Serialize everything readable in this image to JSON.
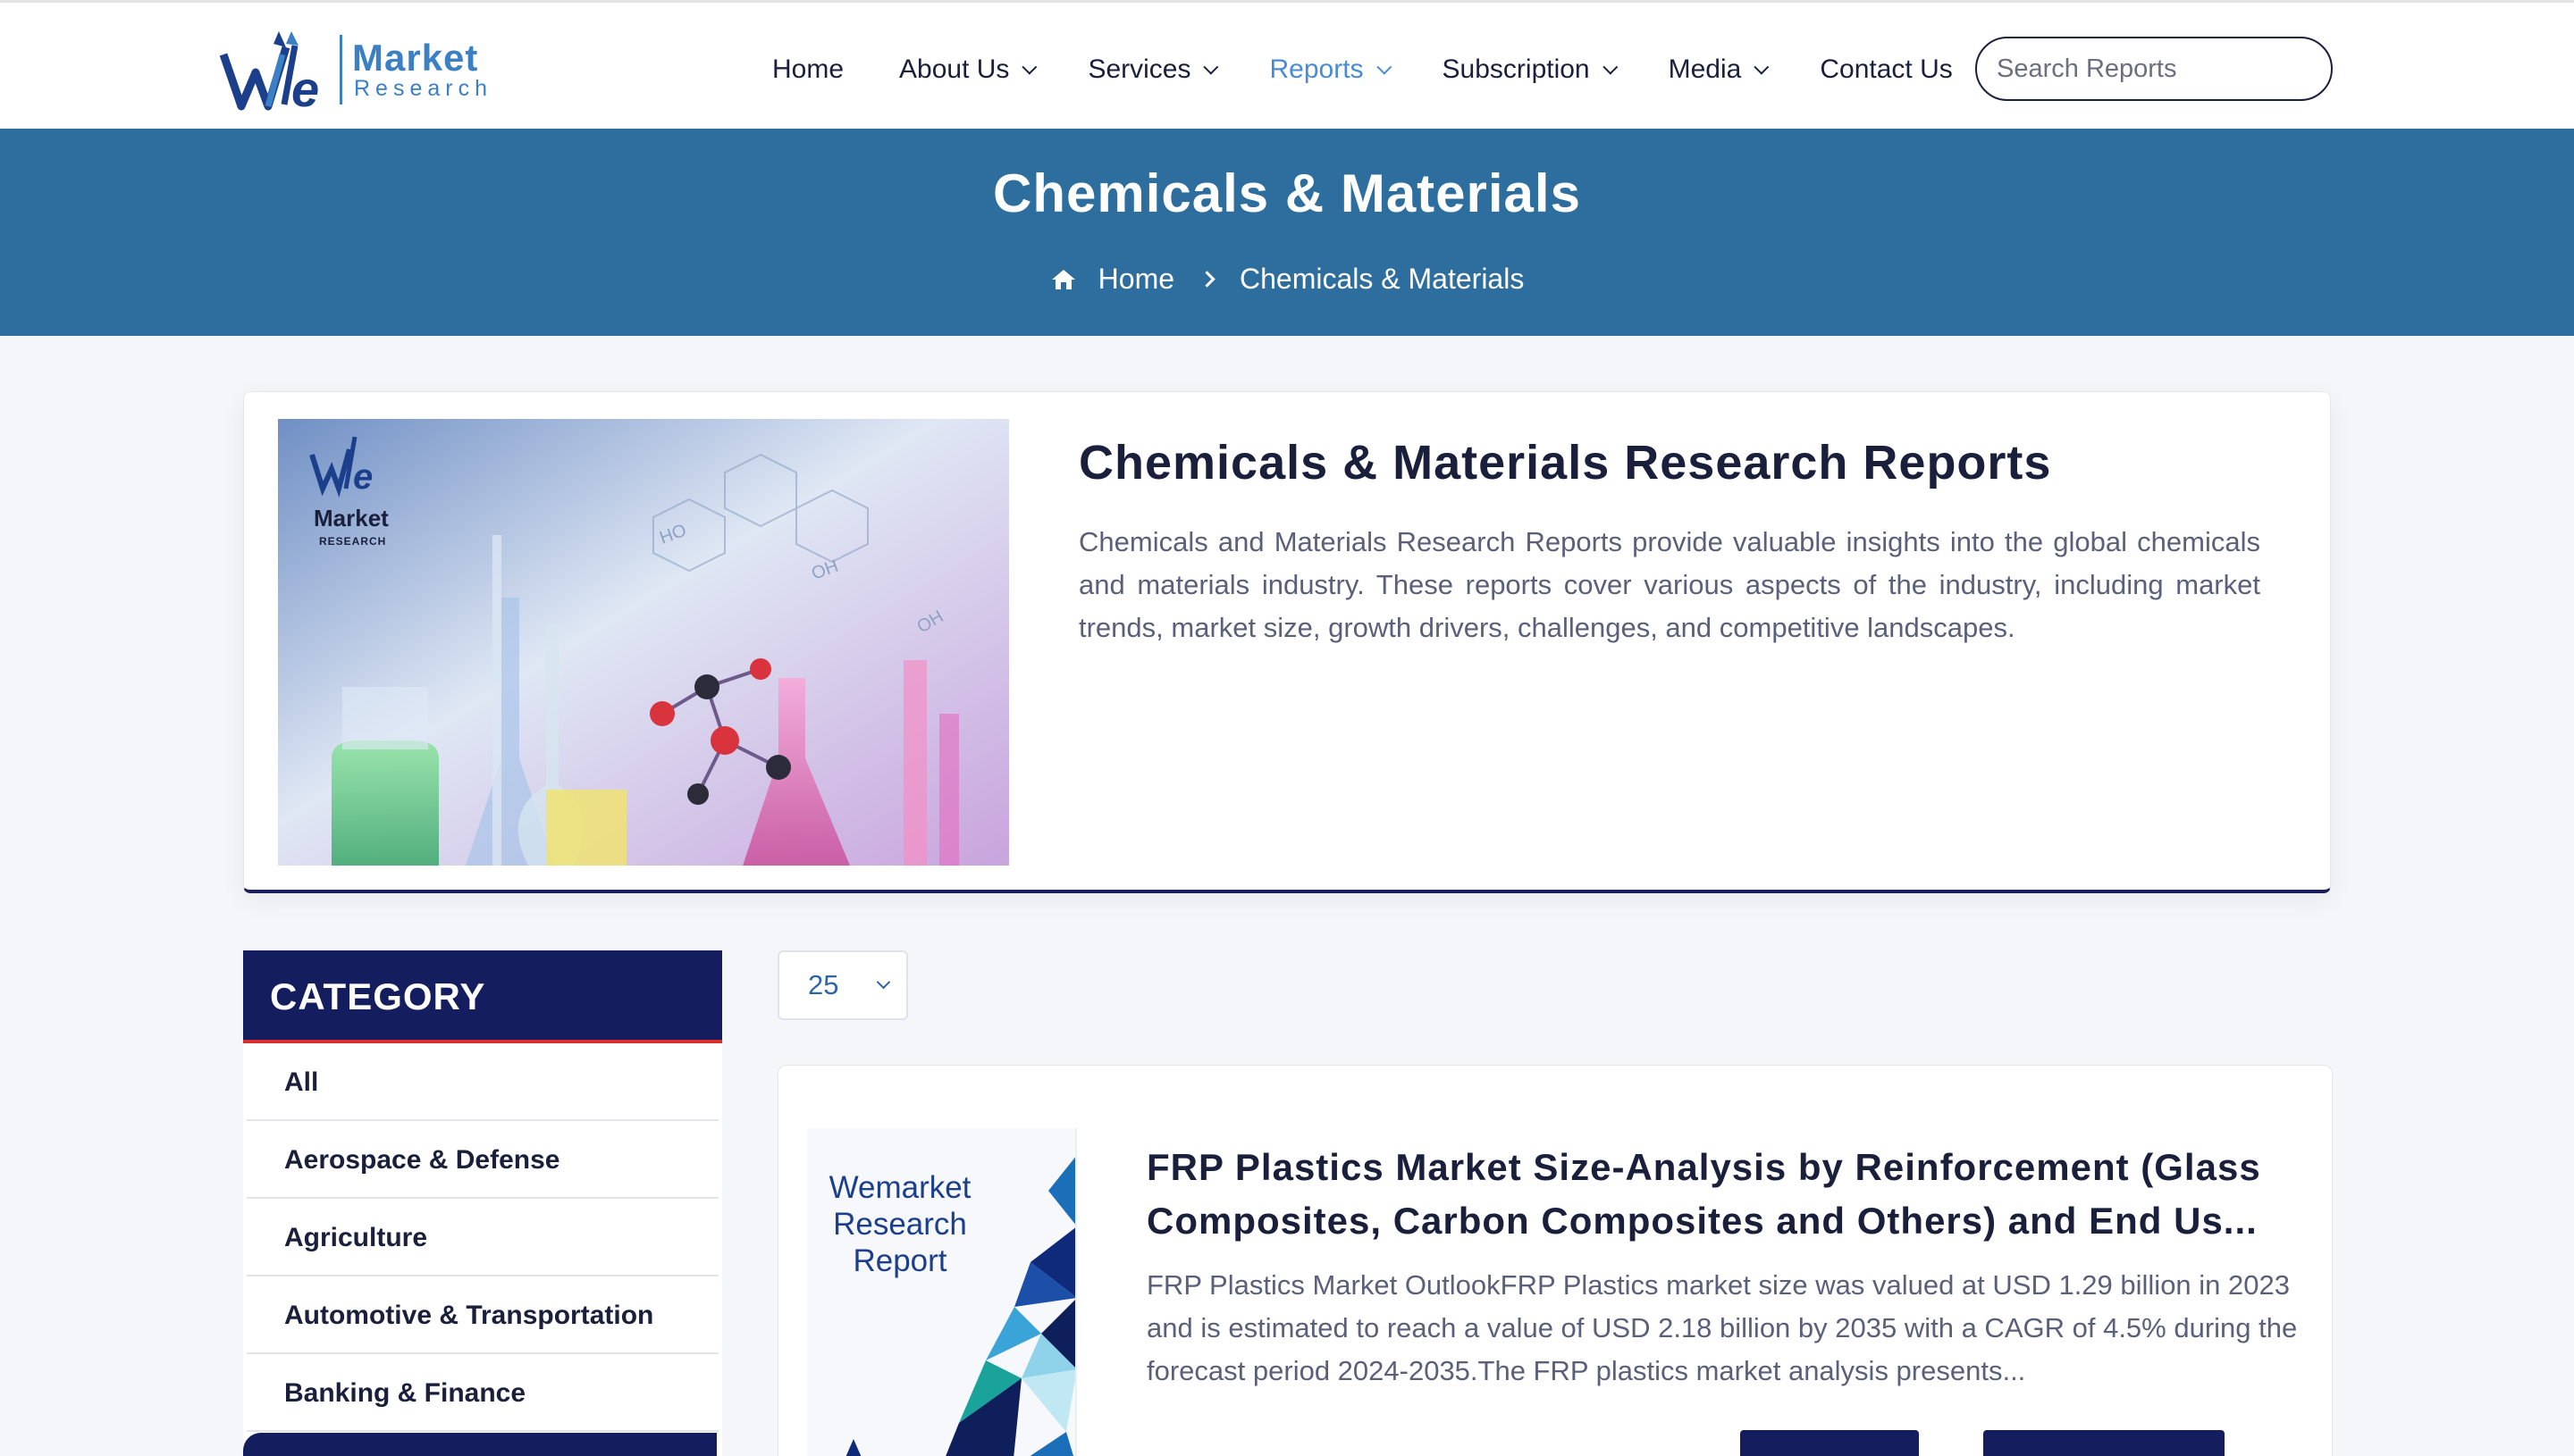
{
  "logo": {
    "main": "Market",
    "sub": "Research"
  },
  "nav": {
    "items": [
      {
        "label": "Home",
        "dropdown": false,
        "active": false
      },
      {
        "label": "About Us",
        "dropdown": true,
        "active": false
      },
      {
        "label": "Services",
        "dropdown": true,
        "active": false
      },
      {
        "label": "Reports",
        "dropdown": true,
        "active": true
      },
      {
        "label": "Subscription",
        "dropdown": true,
        "active": false
      },
      {
        "label": "Media",
        "dropdown": true,
        "active": false
      },
      {
        "label": "Contact Us",
        "dropdown": false,
        "active": false
      }
    ],
    "active_color": "#4a8bd6"
  },
  "search": {
    "placeholder": "Search Reports",
    "button_icon": "search-icon"
  },
  "banner": {
    "title": "Chemicals & Materials",
    "breadcrumb": {
      "home": "Home",
      "current": "Chemicals & Materials"
    },
    "color": "#2e6e9e"
  },
  "intro": {
    "title": "Chemicals & Materials Research Reports",
    "description": "Chemicals and Materials Research Reports provide valuable insights into the global chemicals and materials industry. These reports cover various aspects of the industry, including market trends, market size, growth drivers, challenges, and competitive landscapes.",
    "image_logo": {
      "main": "Market",
      "sub": "RESEARCH"
    }
  },
  "sidebar": {
    "heading": "CATEGORY",
    "items": [
      "All",
      "Aerospace & Defense",
      "Agriculture",
      "Automotive & Transportation",
      "Banking & Finance"
    ]
  },
  "per_page": {
    "value": "25"
  },
  "reports": [
    {
      "cover_text": "Wemarket Research Report",
      "title": "FRP Plastics Market Size-Analysis by Reinforcement (Glass Composites, Carbon Composites and Others) and End Us...",
      "description": "FRP Plastics Market OutlookFRP Plastics market size was valued at USD 1.29 billion in 2023 and is estimated to reach a value of USD 2.18 billion by 2035 with a CAGR of 4.5% during the forecast period 2024-2035.The FRP plastics market analysis presents..."
    }
  ]
}
